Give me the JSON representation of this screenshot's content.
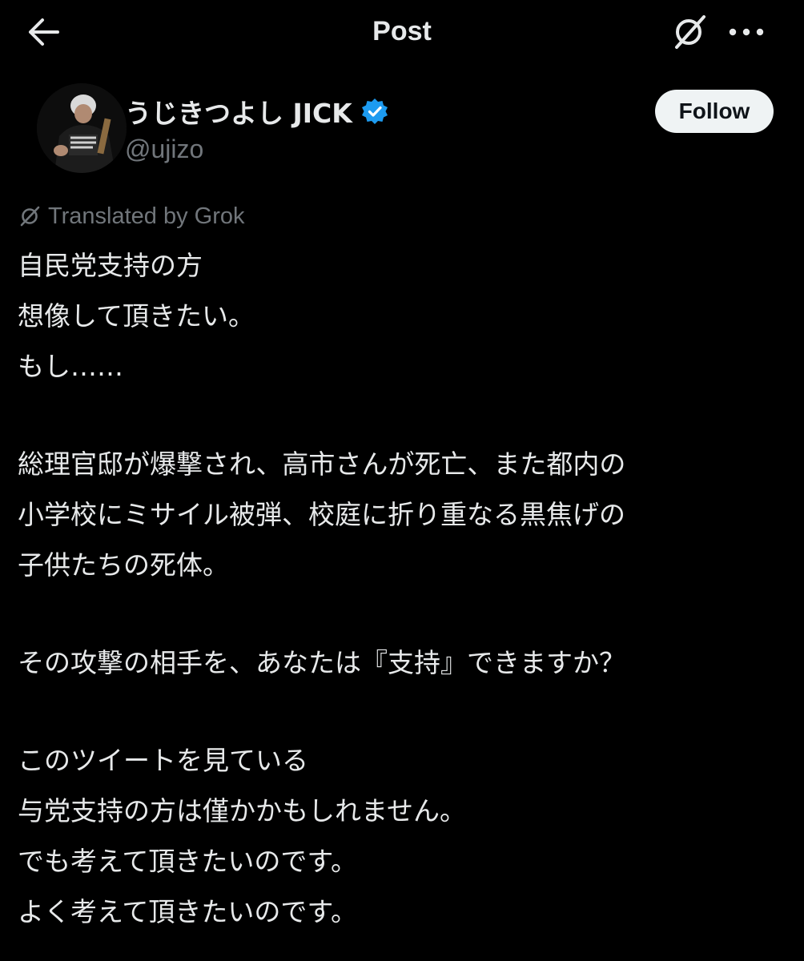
{
  "header": {
    "title": "Post",
    "back_icon": "arrow-left-icon",
    "grok_icon": "grok-icon",
    "more_icon": "more-horizontal-icon"
  },
  "author": {
    "display_name": "うじきつよし JICK",
    "handle": "@ujizo",
    "verified": true,
    "verified_color": "#1d9bf0",
    "avatar_icon": "avatar-photo"
  },
  "follow_button": {
    "label": "Follow"
  },
  "translation": {
    "label": "Translated by Grok",
    "icon": "grok-icon"
  },
  "post": {
    "lines": [
      "自民党支持の方",
      "想像して頂きたい。",
      "もし……",
      "",
      "総理官邸が爆撃され、高市さんが死亡、また都内の",
      "小学校にミサイル被弾、校庭に折り重なる黒焦げの",
      "子供たちの死体。",
      "",
      "その攻撃の相手を、あなたは『支持』できますか？",
      "",
      "このツイートを見ている",
      "与党支持の方は僅かかもしれません。",
      "でも考えて頂きたいのです。",
      "よく考えて頂きたいのです。"
    ]
  },
  "colors": {
    "background": "#000000",
    "text_primary": "#e7e9ea",
    "text_secondary": "#71767b",
    "follow_bg": "#eff3f4",
    "follow_text": "#0f1419"
  }
}
